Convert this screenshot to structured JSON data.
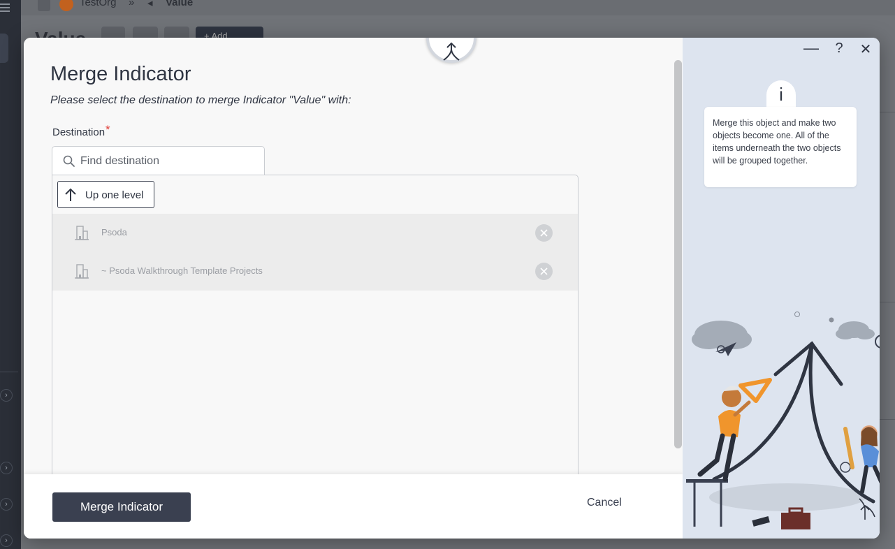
{
  "background": {
    "breadcrumb_org": "TestOrg",
    "breadcrumb_sep": "»",
    "breadcrumb_back": "◂",
    "breadcrumb_current": "Value",
    "page_title": "Value",
    "add_button": "+ Add"
  },
  "dialog": {
    "title": "Merge Indicator",
    "subtitle": "Please select the destination to merge Indicator \"Value\" with:",
    "destination_label": "Destination",
    "required_mark": "*",
    "search_placeholder": "Find destination",
    "up_level_label": "Up one level",
    "items": [
      {
        "name": "Psoda",
        "icon": "building-icon"
      },
      {
        "name": "~ Psoda Walkthrough Template Projects",
        "icon": "building-icon"
      }
    ],
    "merge_button": "Merge Indicator",
    "cancel_button": "Cancel"
  },
  "help_panel": {
    "minimize": "—",
    "help": "?",
    "close": "✕",
    "info_icon": "i",
    "info_text": "Merge this object and make two objects become one. All of the items underneath the two objects will be grouped together."
  },
  "colors": {
    "primary": "#3a4050",
    "panel_bg": "#dde4ef",
    "required": "#e0403a",
    "accent_orange": "#f0952c"
  }
}
